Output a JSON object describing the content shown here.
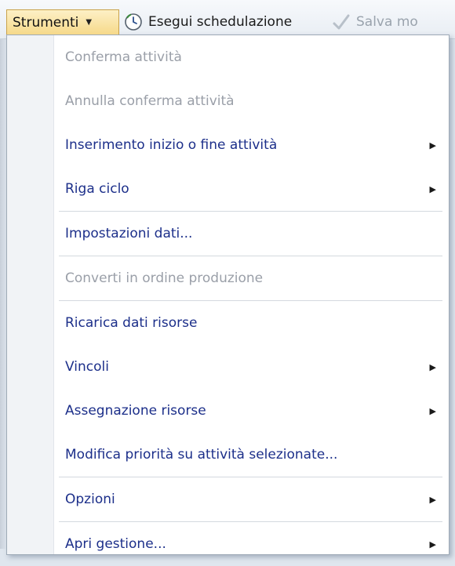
{
  "toolbar": {
    "menu_label": "Strumenti",
    "run_label": "Esegui schedulazione",
    "save_label": "Salva mo"
  },
  "colors": {
    "enabled_text": "#1c2f8a",
    "disabled_text": "#9a9fa8",
    "menu_highlight": "#f6d98a"
  },
  "menu": {
    "items": [
      {
        "label": "Conferma attività",
        "disabled": true,
        "submenu": false
      },
      {
        "label": "Annulla conferma attività",
        "disabled": true,
        "submenu": false
      },
      {
        "label": "Inserimento inizio o fine attività",
        "disabled": false,
        "submenu": true
      },
      {
        "label": "Riga ciclo",
        "disabled": false,
        "submenu": true
      },
      {
        "label": "Impostazioni dati...",
        "disabled": false,
        "submenu": false
      },
      {
        "label": "Converti in ordine produzione",
        "disabled": true,
        "submenu": false
      },
      {
        "label": "Ricarica dati risorse",
        "disabled": false,
        "submenu": false
      },
      {
        "label": "Vincoli",
        "disabled": false,
        "submenu": true
      },
      {
        "label": "Assegnazione risorse",
        "disabled": false,
        "submenu": true
      },
      {
        "label": "Modifica priorità su attività selezionate...",
        "disabled": false,
        "submenu": false
      },
      {
        "label": "Opzioni",
        "disabled": false,
        "submenu": true
      },
      {
        "label": "Apri gestione...",
        "disabled": false,
        "submenu": true
      }
    ]
  }
}
